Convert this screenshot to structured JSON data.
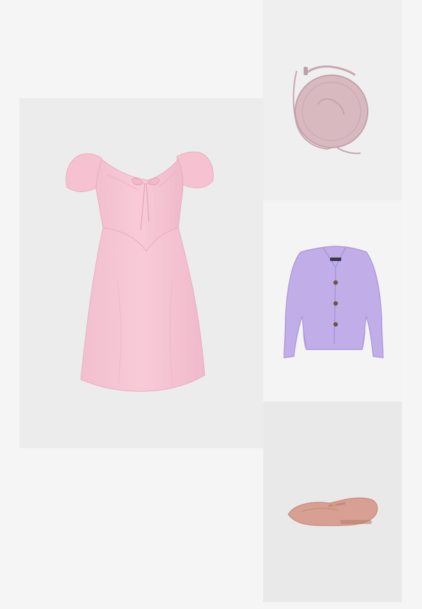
{
  "outfit": {
    "items": [
      {
        "name": "Pink puff-sleeve mini dress",
        "color": "#f7c8d6"
      },
      {
        "name": "Pink round crossbody bag",
        "color": "#d8b9c0"
      },
      {
        "name": "Lilac knit cardigan",
        "color": "#c1aee8"
      },
      {
        "name": "Nude pink ballet flats",
        "color": "#d7a092"
      }
    ]
  },
  "colors": {
    "page_background": "#f5f5f5",
    "tile_background_light": "#f4f4f4",
    "tile_background_mid": "#ececec"
  }
}
